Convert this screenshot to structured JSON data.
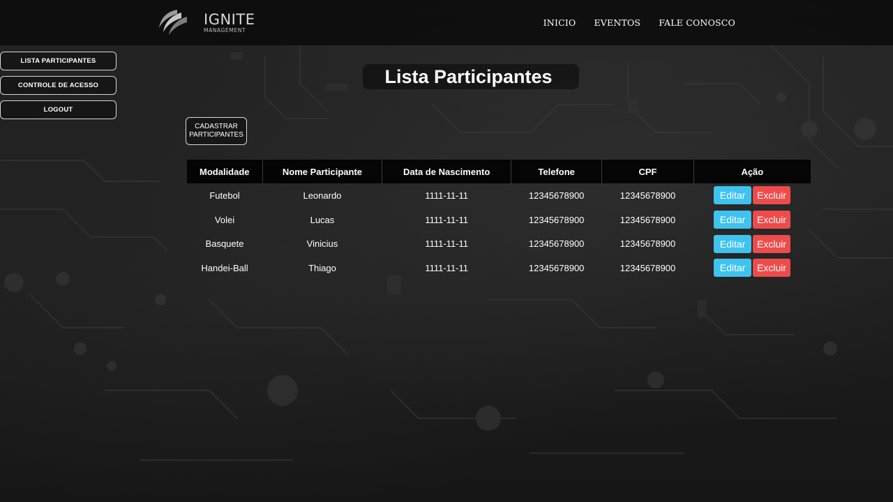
{
  "brand": {
    "name": "IGNITE",
    "tagline": "MANAGEMENT"
  },
  "nav": {
    "items": [
      "INICIO",
      "EVENTOS",
      "FALE CONOSCO"
    ]
  },
  "sidebar": {
    "items": [
      "LISTA PARTICIPANTES",
      "CONTROLE DE ACESSO",
      "LOGOUT"
    ]
  },
  "page": {
    "title": "Lista Participantes",
    "register_button": {
      "line1": "CADASTRAR",
      "line2": "PARTICIPANTES"
    }
  },
  "table": {
    "headers": [
      "Modalidade",
      "Nome Participante",
      "Data de Nascimento",
      "Telefone",
      "CPF",
      "Ação"
    ],
    "rows": [
      {
        "modalidade": "Futebol",
        "nome": "Leonardo",
        "nascimento": "1111-11-11",
        "telefone": "12345678900",
        "cpf": "12345678900"
      },
      {
        "modalidade": "Volei",
        "nome": "Lucas",
        "nascimento": "1111-11-11",
        "telefone": "12345678900",
        "cpf": "12345678900"
      },
      {
        "modalidade": "Basquete",
        "nome": "Vinicius",
        "nascimento": "1111-11-11",
        "telefone": "12345678900",
        "cpf": "12345678900"
      },
      {
        "modalidade": "Handei-Ball",
        "nome": "Thiago",
        "nascimento": "1111-11-11",
        "telefone": "12345678900",
        "cpf": "12345678900"
      }
    ],
    "edit_label": "Editar",
    "delete_label": "Excluir"
  },
  "colors": {
    "edit": "#3fc3ee",
    "delete": "#ee4b4b",
    "header_bg": "#0a0a0a"
  }
}
